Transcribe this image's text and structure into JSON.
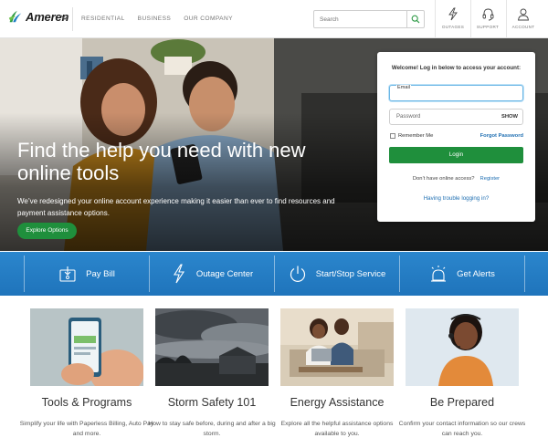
{
  "header": {
    "logo_text": "Ameren",
    "nav": [
      "RESIDENTIAL",
      "BUSINESS",
      "OUR COMPANY"
    ],
    "search_placeholder": "Search",
    "utility": [
      {
        "label": "OUTAGES",
        "icon": "lightning-icon"
      },
      {
        "label": "SUPPORT",
        "icon": "headset-icon"
      },
      {
        "label": "ACCOUNT",
        "icon": "user-icon"
      }
    ]
  },
  "hero": {
    "title": "Find the help you need with new online tools",
    "description": "We’ve redesigned your online account experience making it easier than ever to find resources and payment assistance options.",
    "button": "Explore Options"
  },
  "login": {
    "heading": "Welcome! Log in below to access your account:",
    "email_label": "Email",
    "password_label": "Password",
    "show_label": "SHOW",
    "remember_label": "Remember Me",
    "forgot_label": "Forgot Password",
    "login_button": "Login",
    "no_access_text": "Don’t have online access?",
    "register_label": "Register",
    "trouble_label": "Having trouble logging in?"
  },
  "actions": [
    {
      "label": "Pay Bill",
      "icon": "pay-bill-icon"
    },
    {
      "label": "Outage Center",
      "icon": "lightning-icon"
    },
    {
      "label": "Start/Stop Service",
      "icon": "power-icon"
    },
    {
      "label": "Get Alerts",
      "icon": "alarm-icon"
    }
  ],
  "cards": [
    {
      "title": "Tools & Programs",
      "description": "Simplify your life with Paperless Billing, Auto Pay and more."
    },
    {
      "title": "Storm Safety 101",
      "description": "How to stay safe before, during and after a big storm."
    },
    {
      "title": "Energy Assistance",
      "description": "Explore all the helpful assistance options available to you."
    },
    {
      "title": "Be Prepared",
      "description": "Confirm your contact information so our crews can reach you."
    }
  ],
  "colors": {
    "brand_green": "#1f8f3c",
    "action_blue": "#1f74bb",
    "link_blue": "#1f6fb2"
  }
}
